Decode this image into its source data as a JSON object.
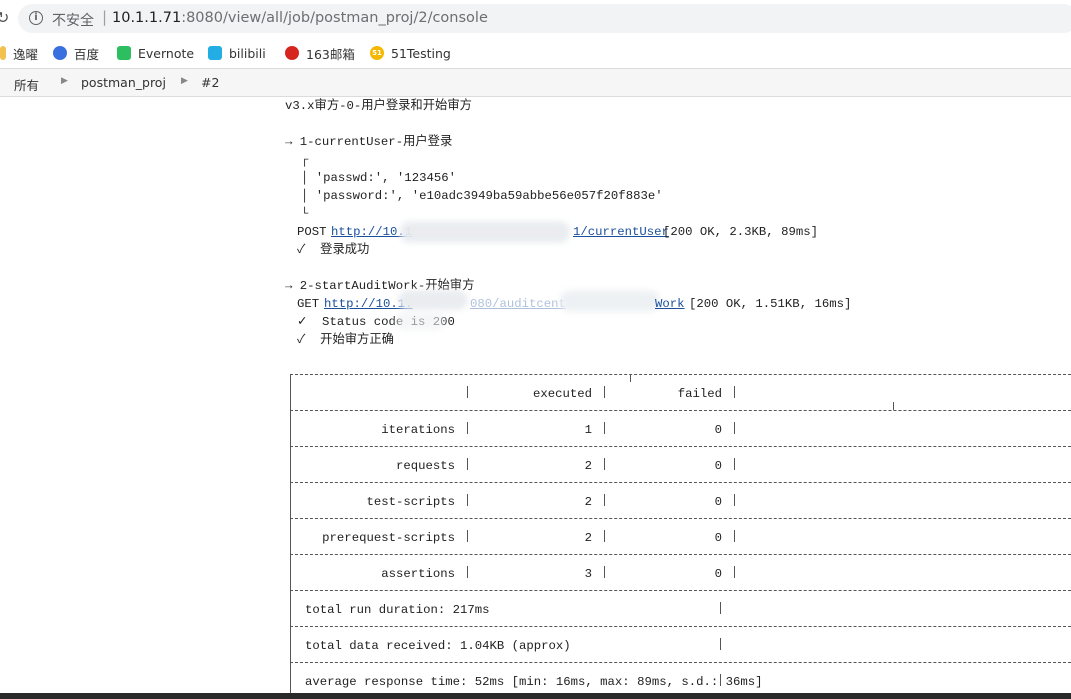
{
  "browser": {
    "security_label": "不安全",
    "url_host": "10.1.1.71",
    "url_path": ":8080/view/all/job/postman_proj/2/console",
    "bookmarks": [
      {
        "label": "逸曜",
        "icon": "yiyue-icon"
      },
      {
        "label": "百度",
        "icon": "baidu-paw-icon"
      },
      {
        "label": "Evernote",
        "icon": "evernote-icon"
      },
      {
        "label": "bilibili",
        "icon": "bilibili-tv-icon"
      },
      {
        "label": "163邮箱",
        "icon": "mail-163-icon"
      },
      {
        "label": "51Testing",
        "icon": "51testing-icon"
      }
    ]
  },
  "breadcrumbs": [
    "所有",
    "postman_proj",
    "#2"
  ],
  "console": {
    "collection_title": "v3.x审方-0-用户登录和开始审方",
    "request1": {
      "arrow_name": "→ 1-currentUser-用户登录",
      "box_top": "┌",
      "log_lines": [
        "│ 'passwd:', '123456'",
        "│ 'password:', 'e10adc3949ba59abbe56e057f20f883e'"
      ],
      "box_bottom": "└",
      "method": "POST",
      "url_visible_start": "http://10.1",
      "url_visible_end": "1/currentUser",
      "stats": "[200 OK, 2.3KB, 89ms]",
      "assertions": [
        "✓  登录成功"
      ]
    },
    "request2": {
      "arrow_name": "→ 2-startAuditWork-开始审方",
      "method": "GET",
      "url_visible_start": "http://10.1.",
      "url_visible_mid": "080/auditcent",
      "url_visible_end": "Work",
      "stats": "[200 OK, 1.51KB, 16ms]",
      "assertions": [
        "✓  Status code is 200",
        "✓  开始审方正确"
      ]
    },
    "summary": {
      "headers": [
        "executed",
        "failed"
      ],
      "rows": [
        {
          "label": "iterations",
          "executed": "1",
          "failed": "0"
        },
        {
          "label": "requests",
          "executed": "2",
          "failed": "0"
        },
        {
          "label": "test-scripts",
          "executed": "2",
          "failed": "0"
        },
        {
          "label": "prerequest-scripts",
          "executed": "2",
          "failed": "0"
        },
        {
          "label": "assertions",
          "executed": "3",
          "failed": "0"
        }
      ],
      "total_run_duration": "total run duration: 217ms",
      "total_data_received": "total data received: 1.04KB (approx)",
      "average_response_time": "average response time: 52ms [min: 16ms, max: 89ms, s.d.: 36ms]"
    }
  }
}
